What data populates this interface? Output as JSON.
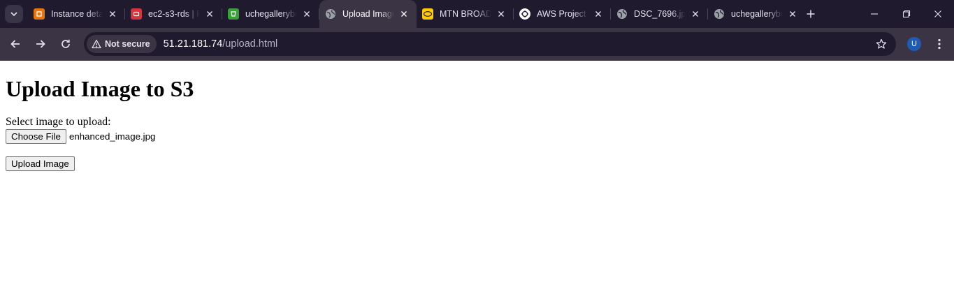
{
  "browser": {
    "tabs": [
      {
        "title": "Instance details",
        "icon": "aws-ec2-icon",
        "color": "#e8750d",
        "active": false
      },
      {
        "title": "ec2-s3-rds | RDS",
        "icon": "aws-rds-icon",
        "color": "#d8343b",
        "active": false
      },
      {
        "title": "uchegallerybucket",
        "icon": "aws-s3-icon",
        "color": "#3aa138",
        "active": false
      },
      {
        "title": "Upload Image",
        "icon": "globe-icon",
        "color": "#9aa0a6",
        "active": true
      },
      {
        "title": "MTN BROADBAND",
        "icon": "mtn-icon",
        "color": "#ffcb05",
        "active": false
      },
      {
        "title": "AWS Project",
        "icon": "chatgpt-icon",
        "color": "#ffffff",
        "active": false
      },
      {
        "title": "DSC_7696.jpg",
        "icon": "globe-icon",
        "color": "#9aa0a6",
        "active": false
      },
      {
        "title": "uchegallerybucket",
        "icon": "globe-icon",
        "color": "#9aa0a6",
        "active": false
      }
    ],
    "security_chip": "Not secure",
    "url_host": "51.21.181.74",
    "url_path": "/upload.html",
    "profile_initial": "U"
  },
  "page": {
    "heading": "Upload Image to S3",
    "select_label": "Select image to upload:",
    "choose_file_label": "Choose File",
    "selected_filename": "enhanced_image.jpg",
    "submit_label": "Upload Image"
  }
}
